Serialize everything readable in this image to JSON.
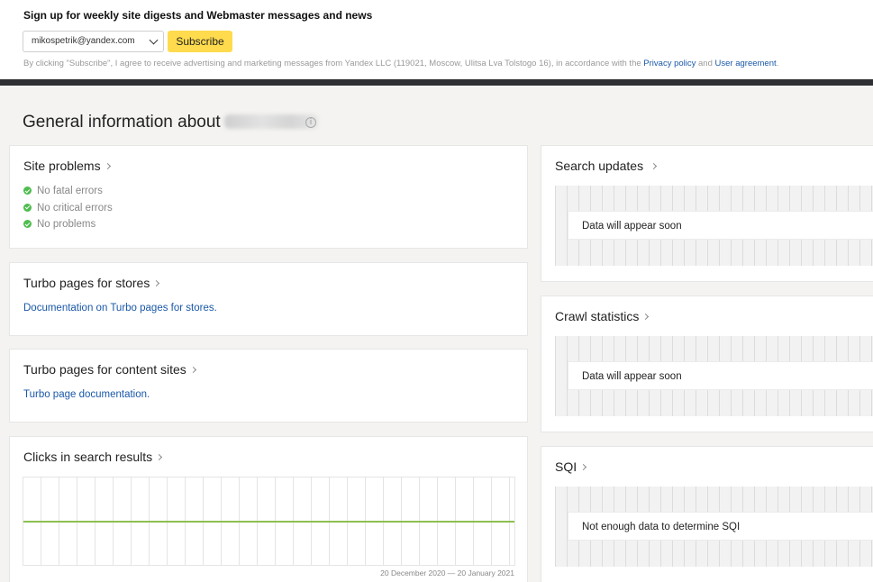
{
  "subscribe": {
    "heading": "Sign up for weekly site digests and Webmaster messages and news",
    "email": "mikospetrik@yandex.com",
    "button_label": "Subscribe",
    "disclaimer": "By clicking \"Subscribe\", I agree to receive advertising and marketing messages from Yandex LLC (119021, Moscow, Ulitsa Lva Tolstogo 16), in accordance with the",
    "privacy_link": "Privacy policy",
    "and_text": "and",
    "agreement_link": "User agreement",
    "period": "."
  },
  "page": {
    "title": "General information about",
    "info_icon": "i"
  },
  "site_problems": {
    "title": "Site problems",
    "items": [
      "No fatal errors",
      "No critical errors",
      "No problems"
    ]
  },
  "turbo_stores": {
    "title": "Turbo pages for stores",
    "link": "Documentation on Turbo pages for stores."
  },
  "turbo_content": {
    "title": "Turbo pages for content sites",
    "link": "Turbo page documentation."
  },
  "clicks": {
    "title": "Clicks in search results",
    "date_range": "20 December 2020 — 20 January 2021"
  },
  "search_updates": {
    "title": "Search updates",
    "message": "Data will appear soon"
  },
  "crawl_stats": {
    "title": "Crawl statistics",
    "message": "Data will appear soon"
  },
  "sqi": {
    "title": "SQI",
    "message": "Not enough data to determine SQI"
  },
  "colors": {
    "accent_button": "#ffdb4d",
    "link": "#1a58a8",
    "ok": "#4fbc4f",
    "chart_line": "#8cc04f"
  }
}
